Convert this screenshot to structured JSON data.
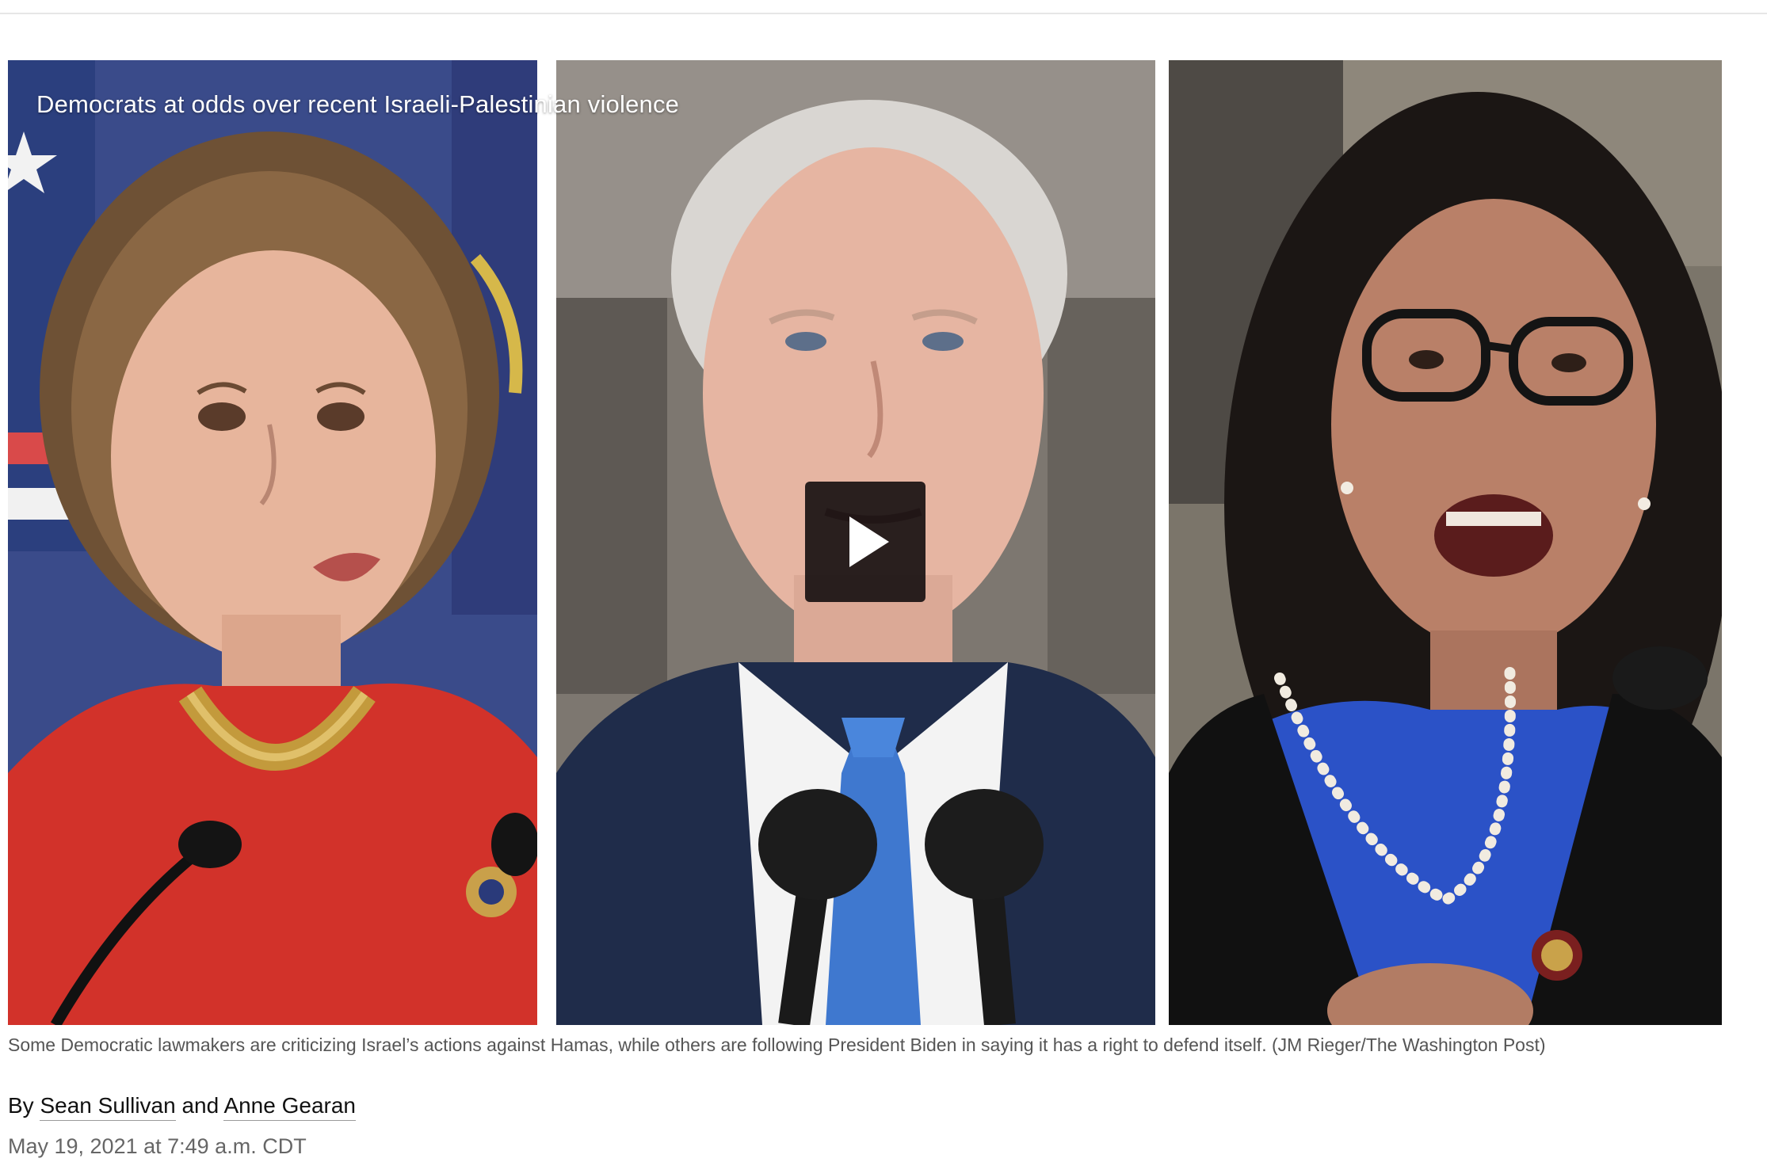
{
  "video": {
    "title": "Democrats at odds over recent Israeli-Palestinian violence",
    "play_icon": "play-icon"
  },
  "caption": "Some Democratic lawmakers are criticizing Israel’s actions against Hamas, while others are following President Biden in saying it has a right to defend itself. (JM Rieger/The Washington Post)",
  "byline": {
    "prefix": "By",
    "author1": "Sean Sullivan",
    "conjunction": "and",
    "author2": "Anne Gearan"
  },
  "dateline": "May 19, 2021 at 7:49 a.m. CDT",
  "colors": {
    "caption_text": "#555555",
    "dateline_text": "#666666",
    "play_button_bg": "#140e10"
  }
}
